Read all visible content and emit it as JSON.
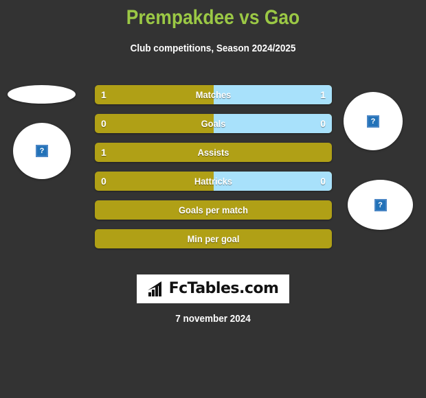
{
  "header": {
    "title": "Prempakdee vs Gao",
    "subtitle": "Club competitions, Season 2024/2025",
    "title_color": "#9BC845",
    "subtitle_color": "#ffffff"
  },
  "colors": {
    "background": "#333333",
    "home_bar": "#B0A016",
    "away_bar": "#A8E1FB",
    "title_green": "#9BC845"
  },
  "media": {
    "left_flag": {
      "icon": "broken-image-icon",
      "glyph": "?",
      "shape": "ellipse"
    },
    "left_avatar": {
      "icon": "broken-image-icon",
      "glyph": "?",
      "shape": "circle"
    },
    "right_avatar": {
      "icon": "broken-image-icon",
      "glyph": "?",
      "shape": "circle"
    },
    "right_flag": {
      "icon": "broken-image-icon",
      "glyph": "?",
      "shape": "ellipse"
    }
  },
  "chart_data": {
    "type": "bar",
    "title": "Prempakdee vs Gao",
    "subtitle": "Club competitions, Season 2024/2025",
    "orientation": "horizontal-diverging",
    "series": [
      {
        "name": "Prempakdee",
        "side": "left",
        "color": "#B0A016"
      },
      {
        "name": "Gao",
        "side": "right",
        "color": "#A8E1FB"
      }
    ],
    "categories": [
      "Matches",
      "Goals",
      "Assists",
      "Hattricks",
      "Goals per match",
      "Min per goal"
    ],
    "rows": [
      {
        "label": "Matches",
        "left_value": "1",
        "right_value": "1",
        "left_pct": 50
      },
      {
        "label": "Goals",
        "left_value": "0",
        "right_value": "0",
        "left_pct": 50
      },
      {
        "label": "Assists",
        "left_value": "1",
        "right_value": "",
        "left_pct": 100
      },
      {
        "label": "Hattricks",
        "left_value": "0",
        "right_value": "0",
        "left_pct": 50
      },
      {
        "label": "Goals per match",
        "left_value": "",
        "right_value": "",
        "left_pct": 100
      },
      {
        "label": "Min per goal",
        "left_value": "",
        "right_value": "",
        "left_pct": 100
      }
    ]
  },
  "logo": {
    "text": "FcTables.com",
    "icon": "bar-chart-arrow-icon"
  },
  "footer": {
    "date": "7 november 2024"
  }
}
